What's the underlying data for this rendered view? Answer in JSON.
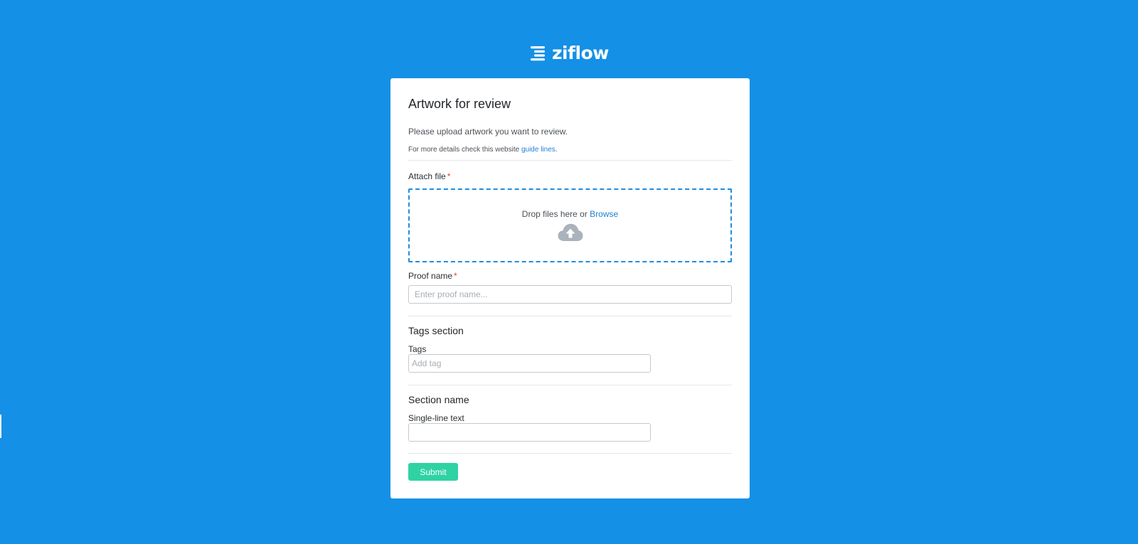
{
  "brand": {
    "name": "ziflow",
    "background_color": "#1490e6",
    "accent_color": "#2fd3a3",
    "icon": "ziflow-logo-icon"
  },
  "form": {
    "title": "Artwork for review",
    "description": "Please upload artwork you want to review.",
    "details_prefix": "For more details check this website ",
    "details_link": "guide lines",
    "details_suffix": ".",
    "attach": {
      "label": "Attach file",
      "required_mark": "*",
      "drop_text": "Drop files here or ",
      "browse_link": "Browse",
      "icon": "cloud-upload-icon"
    },
    "proof_name": {
      "label": "Proof name",
      "required_mark": "*",
      "placeholder": "Enter proof name...",
      "value": ""
    },
    "tags_section": {
      "title": "Tags section",
      "label": "Tags",
      "placeholder": "Add tag",
      "value": ""
    },
    "custom_section": {
      "title": "Section name",
      "label": "Single-line text",
      "placeholder": "",
      "value": ""
    },
    "submit_label": "Submit"
  }
}
